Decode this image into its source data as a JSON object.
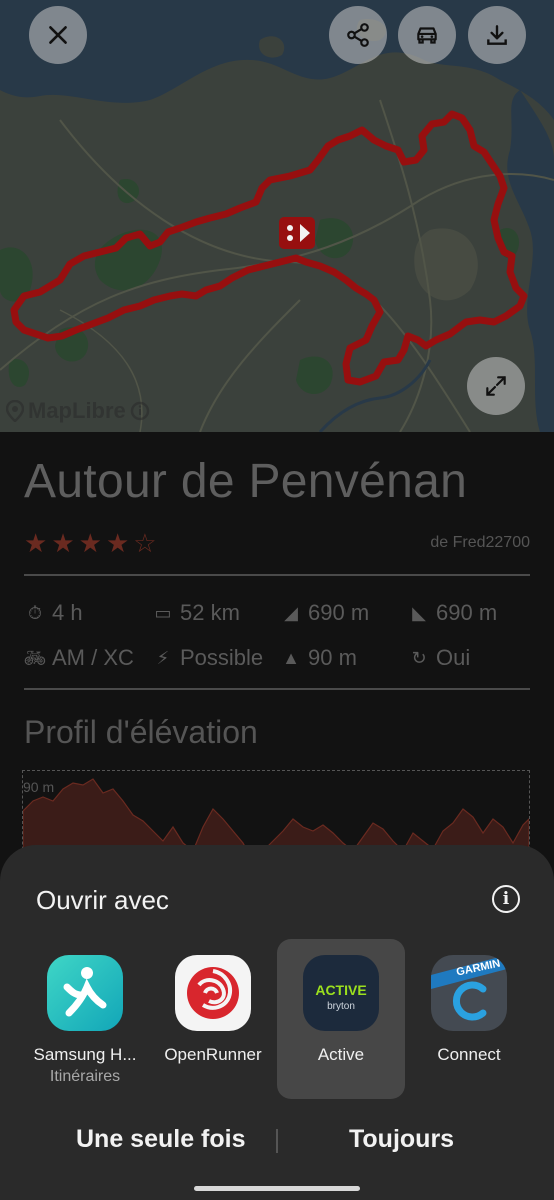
{
  "map": {
    "close_icon": "close-icon",
    "share_icon": "share-icon",
    "car_icon": "car-icon",
    "download_icon": "download-icon",
    "expand_icon": "expand-icon",
    "attribution": "MapLibre",
    "route_color": "#a01010"
  },
  "route": {
    "title": "Autour de Penvénan",
    "rating": 4,
    "rating_max": 5,
    "author": "de Fred22700",
    "stats": [
      {
        "icon": "clock-icon",
        "value": "4 h"
      },
      {
        "icon": "ruler-icon",
        "value": "52 km"
      },
      {
        "icon": "ascent-icon",
        "value": "690 m"
      },
      {
        "icon": "descent-icon",
        "value": "690 m"
      },
      {
        "icon": "mtb-icon",
        "value": "AM / XC"
      },
      {
        "icon": "ebike-icon",
        "value": "Possible"
      },
      {
        "icon": "max-altitude-icon",
        "value": "90 m"
      },
      {
        "icon": "loop-icon",
        "value": "Oui"
      }
    ],
    "profile_title": "Profil d'élévation",
    "profile_max_label": "90 m"
  },
  "sheet": {
    "title": "Ouvrir avec",
    "info_icon": "info-icon",
    "apps": [
      {
        "label": "Samsung H...",
        "sublabel": "Itinéraires",
        "selected": false
      },
      {
        "label": "OpenRunner",
        "sublabel": "",
        "selected": false
      },
      {
        "label": "Active",
        "sublabel": "",
        "selected": true
      },
      {
        "label": "Connect",
        "sublabel": "",
        "selected": false
      }
    ],
    "active_logo_text": "ACTIVE",
    "active_logo_sub": "bryton",
    "garmin_logo_text": "GARMIN",
    "once_label": "Une seule fois",
    "always_label": "Toujours"
  }
}
